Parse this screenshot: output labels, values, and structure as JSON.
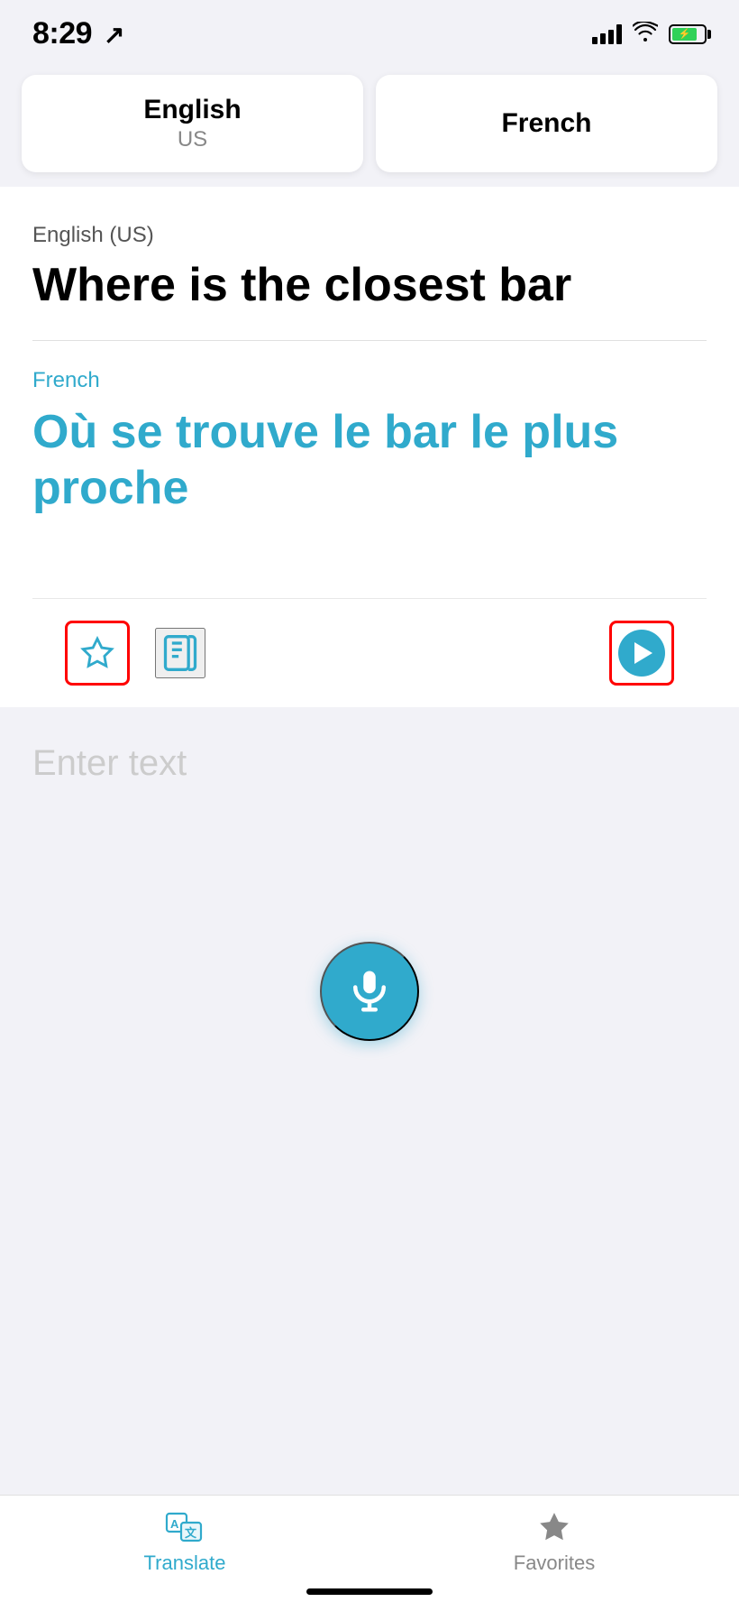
{
  "statusBar": {
    "time": "8:29",
    "locationActive": true
  },
  "languageSelector": {
    "source": {
      "label": "English",
      "sublabel": "US"
    },
    "target": {
      "label": "French"
    }
  },
  "translation": {
    "sourceLanguageLabel": "English (US)",
    "sourceText": "Where is the closest bar",
    "targetLanguageLabel": "French",
    "targetText": "Où se trouve le bar le plus proche"
  },
  "inputArea": {
    "placeholder": "Enter text"
  },
  "tabBar": {
    "tabs": [
      {
        "id": "translate",
        "label": "Translate",
        "active": true
      },
      {
        "id": "favorites",
        "label": "Favorites",
        "active": false
      }
    ]
  },
  "colors": {
    "accent": "#30aacc",
    "danger": "#ff0000",
    "inactive": "#888888"
  }
}
